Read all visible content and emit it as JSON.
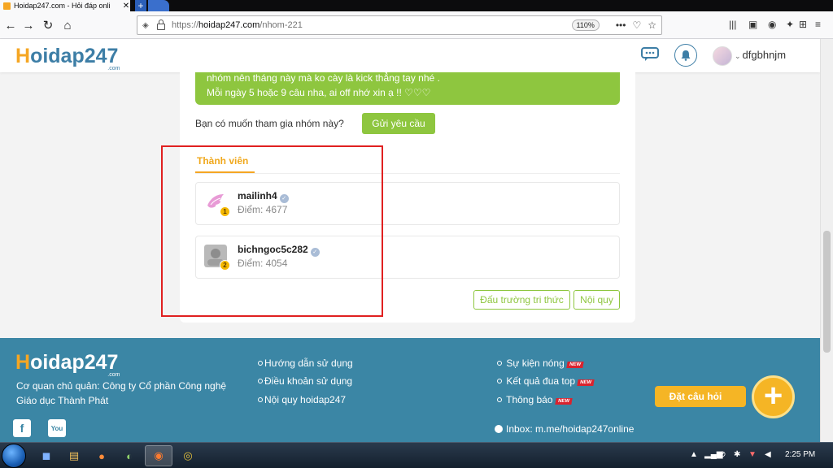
{
  "browser": {
    "tab_title": "Hoidap247.com - Hỏi đáp onli",
    "tab_close": "✕",
    "new_tab": "+",
    "url_protocol": "https://",
    "url_host": "hoidap247.com",
    "url_path": "/nhom-221",
    "zoom": "110%",
    "more": "•••"
  },
  "header": {
    "logo_h": "H",
    "logo_rest": "oidap247",
    "logo_com": ".com",
    "username": "dfgbhnjm"
  },
  "group": {
    "notice_line1": "nhóm nên tháng này mà ko cày là kick thẳng tay nhé .",
    "notice_line2": "Mỗi ngày 5 hoặc 9  câu nha, ai off nhớ xin ạ !!  ♡♡♡",
    "join_question": "Bạn có muốn tham gia nhóm này?",
    "join_button": "Gửi yêu cầu",
    "members_tab": "Thành viên",
    "members": [
      {
        "name": "mailinh4",
        "points": "Điểm: 4677",
        "rank": "1"
      },
      {
        "name": "bichngoc5c282",
        "points": "Điểm: 4054",
        "rank": "2"
      }
    ],
    "arena_button": "Đấu trường tri thức",
    "rules_button": "Nội quy"
  },
  "footer": {
    "logo_h": "H",
    "logo_rest": "oidap247",
    "logo_com": ".com",
    "company_line1": "Cơ quan chủ quản: Công ty Cổ phần Công nghệ",
    "company_line2": "Giáo dục Thành Phát",
    "links_col1": [
      "Hướng dẫn sử dụng",
      "Điều khoản sử dụng",
      "Nội quy hoidap247"
    ],
    "links_col2": [
      "Sự kiện nóng",
      "Kết quả đua top",
      "Thông báo"
    ],
    "new_badge": "NEW",
    "inbox": "Inbox: m.me/hoidap247online",
    "ask_button": "Đặt câu hỏi",
    "plus": "+"
  },
  "taskbar": {
    "clock": "2:25 PM"
  },
  "colors": {
    "brand_blue": "#3d7ea6",
    "brand_orange": "#f5a623",
    "accent_green": "#8ec63f",
    "footer_bg": "#3b86a5",
    "highlight_red": "#e02020"
  }
}
